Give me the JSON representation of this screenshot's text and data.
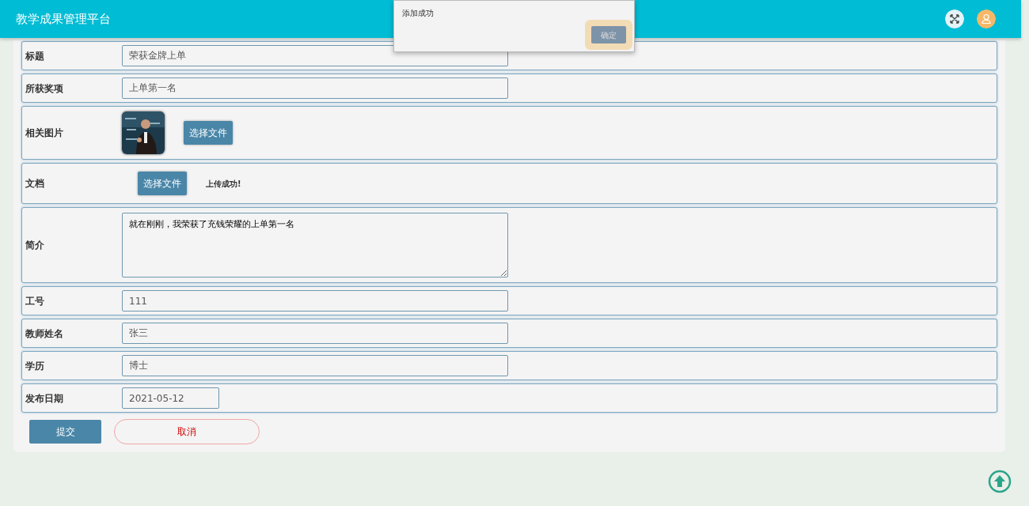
{
  "header": {
    "title": "教学成果管理平台"
  },
  "dialog": {
    "message": "添加成功",
    "button": "确定"
  },
  "fields": [
    {
      "kind": "input",
      "label": "标题",
      "value": "荣获金牌上单"
    },
    {
      "kind": "input",
      "label": "所获奖项",
      "value": "上单第一名"
    },
    {
      "label": "相关图片",
      "button": "选择文件"
    },
    {
      "kind": "file",
      "label": "文档",
      "button": "选择文件",
      "status": "上传成功!"
    },
    {
      "kind": "textarea",
      "label": "简介",
      "value": "就在刚刚，我荣获了充钱荣耀的上单第一名"
    },
    {
      "kind": "input",
      "label": "工号",
      "value": "111"
    },
    {
      "kind": "input",
      "label": "教师姓名",
      "value": "张三"
    },
    {
      "kind": "input",
      "label": "学历",
      "value": "博士"
    },
    {
      "kind": "date",
      "label": "发布日期",
      "value": "2021-05-12"
    }
  ],
  "actions": {
    "submit": "提交",
    "cancel": "取消"
  }
}
